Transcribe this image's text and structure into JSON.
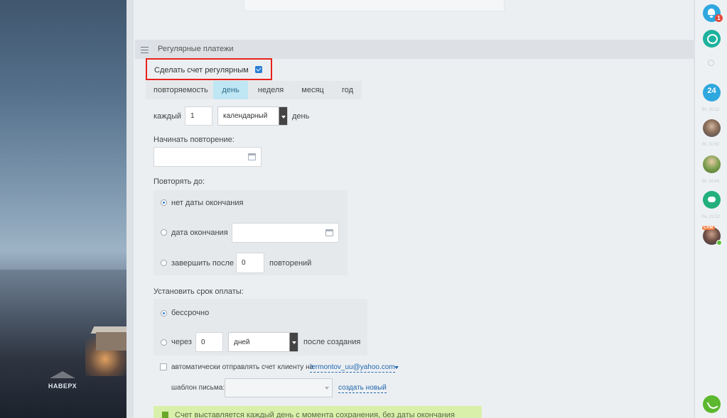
{
  "wallpaper": {
    "up_label": "НАВЕРХ"
  },
  "section": {
    "title": "Регулярные платежи"
  },
  "make_regular": {
    "label": "Сделать счет регулярным",
    "checked": true
  },
  "repeat": {
    "label": "повторяемость",
    "options": [
      "день",
      "неделя",
      "месяц",
      "год"
    ],
    "active": "день"
  },
  "every": {
    "label": "каждый",
    "value": "1",
    "type_selected": "календарный",
    "unit": "день"
  },
  "start": {
    "label": "Начинать повторение:",
    "date": ""
  },
  "repeat_until": {
    "label": "Повторять до:",
    "options": {
      "no_end": "нет даты окончания",
      "end_date": "дата окончания",
      "finish_after": "завершить после",
      "repetitions_unit": "повторений"
    },
    "selected": "no_end",
    "repetitions_value": "0"
  },
  "payment_term": {
    "label": "Установить срок оплаты:",
    "options": {
      "indefinite": "бессрочно",
      "after": "через",
      "after_suffix": "после создания"
    },
    "selected": "indefinite",
    "days_value": "0",
    "days_unit_selected": "дней"
  },
  "auto_send": {
    "label": "автоматически отправлять счет клиенту на",
    "email": "lermontov_uu@yahoo.com",
    "checked": false
  },
  "template": {
    "label": "шаблон письма:",
    "value": "",
    "create_link": "создать новый"
  },
  "notice": {
    "text": "Счет выставляется каждый день с момента сохранения, без даты окончания"
  },
  "rail": {
    "notifications_badge": "1",
    "calendar_label": "24",
    "crm_badge": "CRM",
    "timestamps": [
      "Вт, 15:32",
      "Вт, 11:50",
      "Вт, 10:44",
      "Пн, 21:52"
    ]
  },
  "colors": {
    "accent_blue": "#2a7fd4",
    "highlight_red": "#e8221b",
    "notice_green": "#d9f0ab",
    "phone_green": "#5cb82f"
  }
}
